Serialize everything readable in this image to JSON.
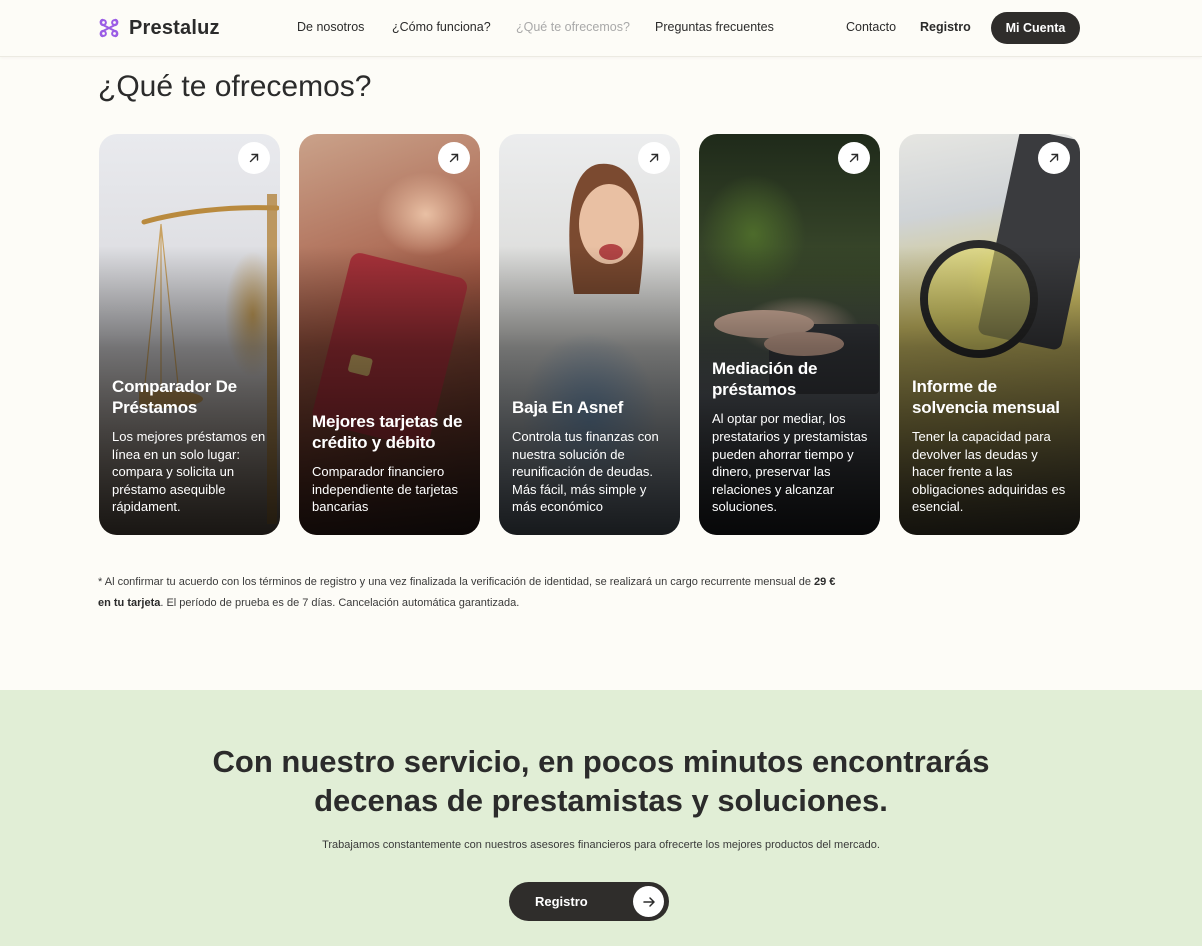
{
  "brand": {
    "name": "Prestaluz",
    "accent_color": "#9b5de5"
  },
  "nav": {
    "items": [
      {
        "label": "De nosotros"
      },
      {
        "label": "¿Cómo funciona?"
      },
      {
        "label": "¿Qué te ofrecemos?",
        "active": true
      },
      {
        "label": "Preguntas frecuentes"
      }
    ],
    "contact_label": "Contacto",
    "register_label": "Registro",
    "account_label": "Mi Cuenta"
  },
  "offers": {
    "title": "¿Qué te ofrecemos?",
    "cards": [
      {
        "title": "Comparador De Préstamos",
        "description": "Los mejores préstamos en línea en un solo lugar: compara y solicita un préstamo asequible rápidament.",
        "icon": "arrow-up-right-icon"
      },
      {
        "title": "Mejores tarjetas de crédito y débito",
        "description": "Comparador financiero independiente de tarjetas bancarias",
        "icon": "arrow-up-right-icon"
      },
      {
        "title": "Baja En Asnef",
        "description": "Controla tus finanzas con nuestra solución de reunificación de deudas. Más fácil, más simple y más económico",
        "icon": "arrow-up-right-icon"
      },
      {
        "title": "Mediación de préstamos",
        "description": "Al optar por mediar, los prestatarios y prestamistas pueden ahorrar tiempo y dinero, preservar las relaciones y alcanzar soluciones.",
        "icon": "arrow-up-right-icon"
      },
      {
        "title": "Informe de solvencia mensual",
        "description": "Tener la capacidad para devolver las deudas y hacer frente a las obligaciones adquiridas es esencial.",
        "icon": "arrow-up-right-icon"
      }
    ],
    "footnote": {
      "prefix": "* Al confirmar tu acuerdo con los términos de registro y una vez finalizada la verificación de identidad, se realizará un cargo recurrente mensual de ",
      "price": "29 € en tu tarjeta",
      "suffix": ". El período de prueba es de 7 días. Cancelación automática garantizada."
    }
  },
  "promo": {
    "title_line1": "Con nuestro servicio, en pocos minutos encontrarás",
    "title_line2": "decenas de prestamistas y soluciones.",
    "subtitle": "Trabajamos constantemente con nuestros asesores financieros para ofrecerte los mejores productos del mercado.",
    "button_label": "Registro",
    "button_icon": "arrow-right-icon",
    "background": "#e1eed6"
  }
}
